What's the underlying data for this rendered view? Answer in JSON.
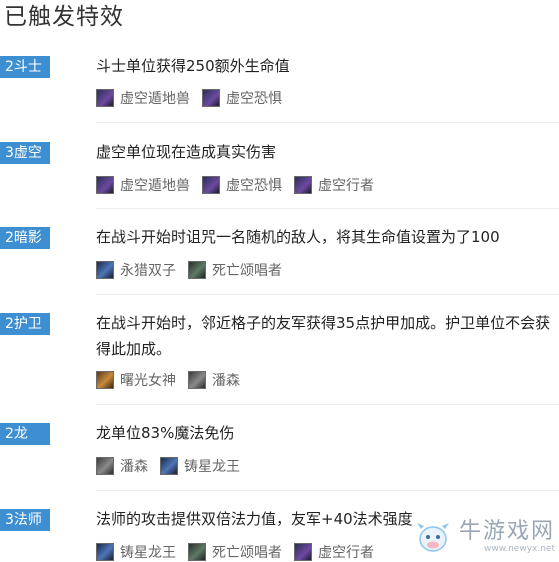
{
  "title": "已触发特效",
  "sections": [
    {
      "badge": "2斗士",
      "desc": "斗士单位获得250额外生命值",
      "champs": [
        {
          "name": "虚空遁地兽",
          "portrait": "purple"
        },
        {
          "name": "虚空恐惧",
          "portrait": "purple"
        }
      ]
    },
    {
      "badge": "3虚空",
      "desc": "虚空单位现在造成真实伤害",
      "champs": [
        {
          "name": "虚空遁地兽",
          "portrait": "purple"
        },
        {
          "name": "虚空恐惧",
          "portrait": "purple"
        },
        {
          "name": "虚空行者",
          "portrait": "purple"
        }
      ]
    },
    {
      "badge": "2暗影",
      "desc": "在战斗开始时诅咒一名随机的敌人，将其生命值设置为了100",
      "champs": [
        {
          "name": "永猎双子",
          "portrait": "blue"
        },
        {
          "name": "死亡颂唱者",
          "portrait": "green"
        }
      ]
    },
    {
      "badge": "2护卫",
      "desc": "在战斗开始时，邻近格子的友军获得35点护甲加成。护卫单位不会获得此加成。",
      "champs": [
        {
          "name": "曙光女神",
          "portrait": "gold"
        },
        {
          "name": "潘森",
          "portrait": "grey"
        }
      ]
    },
    {
      "badge": "2龙",
      "desc": "龙单位83%魔法免伤",
      "champs": [
        {
          "name": "潘森",
          "portrait": "grey"
        },
        {
          "name": "铸星龙王",
          "portrait": "blue"
        }
      ]
    },
    {
      "badge": "3法师",
      "desc": "法师的攻击提供双倍法力值，友军+40法术强度",
      "champs": [
        {
          "name": "铸星龙王",
          "portrait": "blue"
        },
        {
          "name": "死亡颂唱者",
          "portrait": "green"
        },
        {
          "name": "虚空行者",
          "portrait": "purple"
        }
      ]
    }
  ],
  "watermark": {
    "name": "牛游戏网",
    "url": "www.newyx.net"
  },
  "colors": {
    "badge_bg": "#3d8fd1",
    "text": "#222222",
    "muted": "#666666"
  }
}
